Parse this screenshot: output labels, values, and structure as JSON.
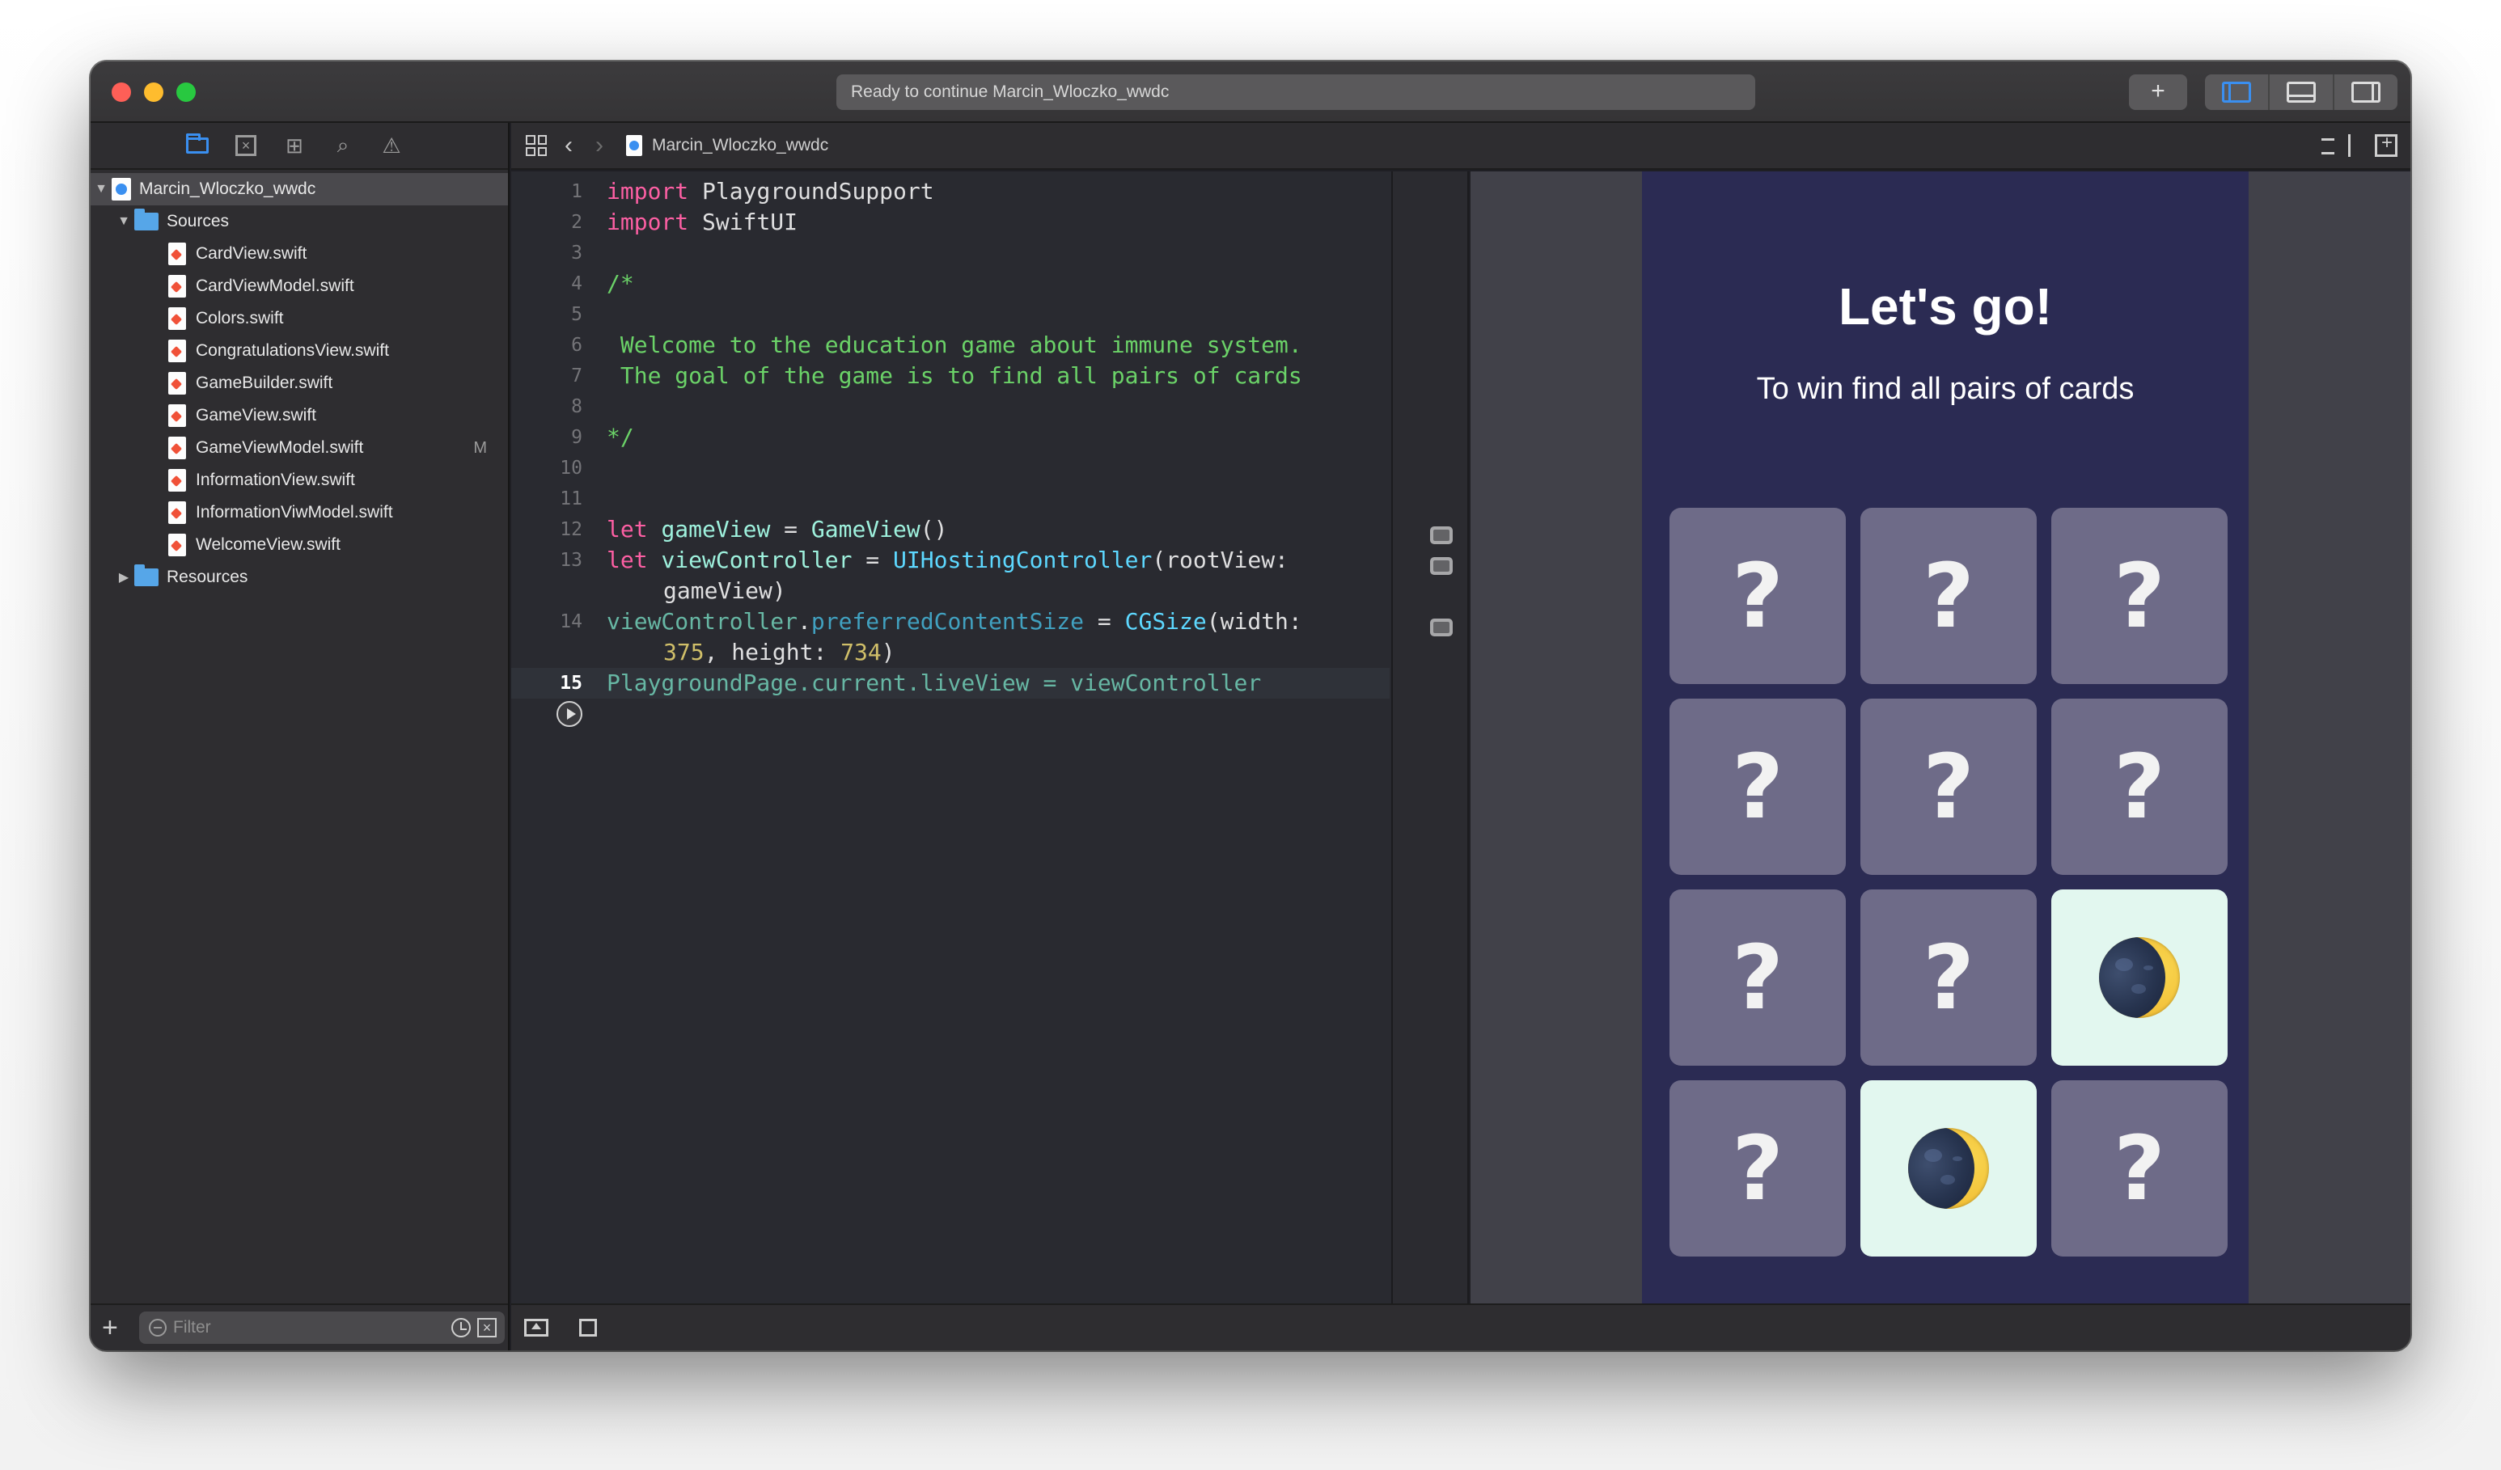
{
  "window": {
    "activity_text": "Ready to continue Marcin_Wloczko_wwdc",
    "add_button": "+"
  },
  "navigator": {
    "project": "Marcin_Wloczko_wwdc",
    "sources_folder": "Sources",
    "files": [
      {
        "name": "CardView.swift",
        "status": ""
      },
      {
        "name": "CardViewModel.swift",
        "status": ""
      },
      {
        "name": "Colors.swift",
        "status": ""
      },
      {
        "name": "CongratulationsView.swift",
        "status": ""
      },
      {
        "name": "GameBuilder.swift",
        "status": ""
      },
      {
        "name": "GameView.swift",
        "status": ""
      },
      {
        "name": "GameViewModel.swift",
        "status": "M"
      },
      {
        "name": "InformationView.swift",
        "status": ""
      },
      {
        "name": "InformationViwModel.swift",
        "status": ""
      },
      {
        "name": "WelcomeView.swift",
        "status": ""
      }
    ],
    "resources_folder": "Resources",
    "filter_placeholder": "Filter"
  },
  "jumpbar": {
    "file": "Marcin_Wloczko_wwdc"
  },
  "editor": {
    "line_numbers": [
      "1",
      "2",
      "3",
      "4",
      "5",
      "6",
      "7",
      "8",
      "9",
      "10",
      "11",
      "12",
      "13",
      "14",
      "15"
    ],
    "current_line": "15",
    "tokens": {
      "import": "import",
      "PlaygroundSupport": " PlaygroundSupport",
      "SwiftUI": " SwiftUI",
      "comment_open": "/*",
      "comment_line1": " Welcome to the education game about immune system.",
      "comment_line2": " The goal of the game is to find all pairs of cards",
      "comment_close": "*/",
      "let": "let",
      "gameView": "gameView",
      "GameView": "GameView",
      "viewController": "viewController",
      "UIHostingController": "UIHostingController",
      "rootView": "(rootView:",
      "gameView_arg": "gameView)",
      "viewController_ref": "viewController",
      "preferredContentSize": "preferredContentSize",
      "CGSize": "CGSize",
      "width": "(width:",
      "width_value": "375",
      "height": ", height: ",
      "height_value": "734",
      "close_paren": ")",
      "PlaygroundPage": "PlaygroundPage",
      "current": "current",
      "liveView": "liveView",
      "equals": " = ",
      "call": "()",
      "dot": "."
    }
  },
  "live_view": {
    "title": "Let's go!",
    "subtitle": "To win find all pairs of cards",
    "card_symbol": "?",
    "cards": [
      {
        "state": "hidden"
      },
      {
        "state": "hidden"
      },
      {
        "state": "hidden"
      },
      {
        "state": "hidden"
      },
      {
        "state": "hidden"
      },
      {
        "state": "hidden"
      },
      {
        "state": "hidden"
      },
      {
        "state": "hidden"
      },
      {
        "state": "moon"
      },
      {
        "state": "hidden"
      },
      {
        "state": "moon"
      },
      {
        "state": "hidden"
      }
    ],
    "colors": {
      "background": "#2b2b53",
      "card_hidden": "#6e6b88",
      "card_revealed": "#e2f7ef"
    }
  }
}
